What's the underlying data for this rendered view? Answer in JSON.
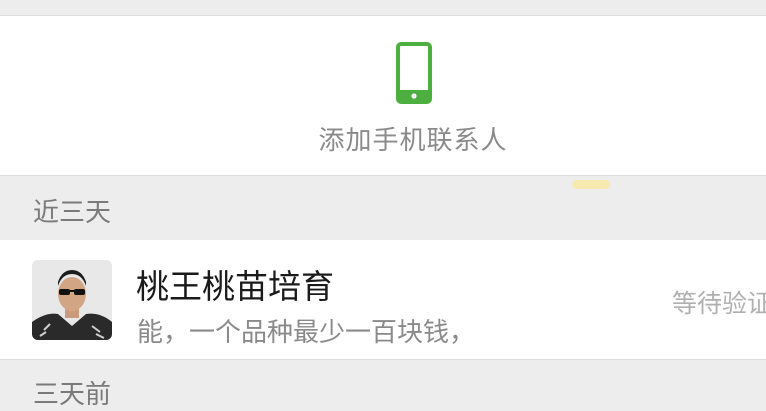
{
  "add_contacts": {
    "label": "添加手机联系人",
    "icon": "phone-icon",
    "icon_color": "#4caf3f"
  },
  "sections": [
    {
      "title": "近三天"
    },
    {
      "title": "三天前"
    }
  ],
  "contacts": [
    {
      "name": "桃王桃苗培育",
      "message": "能，一个品种最少一百块钱，",
      "status": "等待验证"
    }
  ]
}
